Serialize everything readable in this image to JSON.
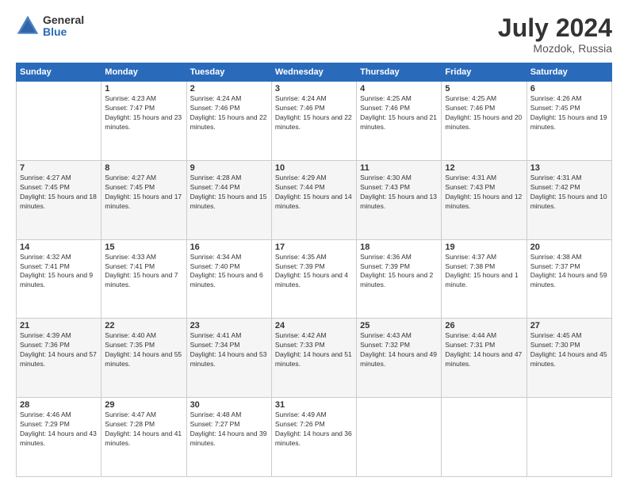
{
  "header": {
    "logo_line1": "General",
    "logo_line2": "Blue",
    "month_year": "July 2024",
    "location": "Mozdok, Russia"
  },
  "days_of_week": [
    "Sunday",
    "Monday",
    "Tuesday",
    "Wednesday",
    "Thursday",
    "Friday",
    "Saturday"
  ],
  "weeks": [
    [
      {
        "day": "",
        "sunrise": "",
        "sunset": "",
        "daylight": ""
      },
      {
        "day": "1",
        "sunrise": "Sunrise: 4:23 AM",
        "sunset": "Sunset: 7:47 PM",
        "daylight": "Daylight: 15 hours and 23 minutes."
      },
      {
        "day": "2",
        "sunrise": "Sunrise: 4:24 AM",
        "sunset": "Sunset: 7:46 PM",
        "daylight": "Daylight: 15 hours and 22 minutes."
      },
      {
        "day": "3",
        "sunrise": "Sunrise: 4:24 AM",
        "sunset": "Sunset: 7:46 PM",
        "daylight": "Daylight: 15 hours and 22 minutes."
      },
      {
        "day": "4",
        "sunrise": "Sunrise: 4:25 AM",
        "sunset": "Sunset: 7:46 PM",
        "daylight": "Daylight: 15 hours and 21 minutes."
      },
      {
        "day": "5",
        "sunrise": "Sunrise: 4:25 AM",
        "sunset": "Sunset: 7:46 PM",
        "daylight": "Daylight: 15 hours and 20 minutes."
      },
      {
        "day": "6",
        "sunrise": "Sunrise: 4:26 AM",
        "sunset": "Sunset: 7:45 PM",
        "daylight": "Daylight: 15 hours and 19 minutes."
      }
    ],
    [
      {
        "day": "7",
        "sunrise": "Sunrise: 4:27 AM",
        "sunset": "Sunset: 7:45 PM",
        "daylight": "Daylight: 15 hours and 18 minutes."
      },
      {
        "day": "8",
        "sunrise": "Sunrise: 4:27 AM",
        "sunset": "Sunset: 7:45 PM",
        "daylight": "Daylight: 15 hours and 17 minutes."
      },
      {
        "day": "9",
        "sunrise": "Sunrise: 4:28 AM",
        "sunset": "Sunset: 7:44 PM",
        "daylight": "Daylight: 15 hours and 15 minutes."
      },
      {
        "day": "10",
        "sunrise": "Sunrise: 4:29 AM",
        "sunset": "Sunset: 7:44 PM",
        "daylight": "Daylight: 15 hours and 14 minutes."
      },
      {
        "day": "11",
        "sunrise": "Sunrise: 4:30 AM",
        "sunset": "Sunset: 7:43 PM",
        "daylight": "Daylight: 15 hours and 13 minutes."
      },
      {
        "day": "12",
        "sunrise": "Sunrise: 4:31 AM",
        "sunset": "Sunset: 7:43 PM",
        "daylight": "Daylight: 15 hours and 12 minutes."
      },
      {
        "day": "13",
        "sunrise": "Sunrise: 4:31 AM",
        "sunset": "Sunset: 7:42 PM",
        "daylight": "Daylight: 15 hours and 10 minutes."
      }
    ],
    [
      {
        "day": "14",
        "sunrise": "Sunrise: 4:32 AM",
        "sunset": "Sunset: 7:41 PM",
        "daylight": "Daylight: 15 hours and 9 minutes."
      },
      {
        "day": "15",
        "sunrise": "Sunrise: 4:33 AM",
        "sunset": "Sunset: 7:41 PM",
        "daylight": "Daylight: 15 hours and 7 minutes."
      },
      {
        "day": "16",
        "sunrise": "Sunrise: 4:34 AM",
        "sunset": "Sunset: 7:40 PM",
        "daylight": "Daylight: 15 hours and 6 minutes."
      },
      {
        "day": "17",
        "sunrise": "Sunrise: 4:35 AM",
        "sunset": "Sunset: 7:39 PM",
        "daylight": "Daylight: 15 hours and 4 minutes."
      },
      {
        "day": "18",
        "sunrise": "Sunrise: 4:36 AM",
        "sunset": "Sunset: 7:39 PM",
        "daylight": "Daylight: 15 hours and 2 minutes."
      },
      {
        "day": "19",
        "sunrise": "Sunrise: 4:37 AM",
        "sunset": "Sunset: 7:38 PM",
        "daylight": "Daylight: 15 hours and 1 minute."
      },
      {
        "day": "20",
        "sunrise": "Sunrise: 4:38 AM",
        "sunset": "Sunset: 7:37 PM",
        "daylight": "Daylight: 14 hours and 59 minutes."
      }
    ],
    [
      {
        "day": "21",
        "sunrise": "Sunrise: 4:39 AM",
        "sunset": "Sunset: 7:36 PM",
        "daylight": "Daylight: 14 hours and 57 minutes."
      },
      {
        "day": "22",
        "sunrise": "Sunrise: 4:40 AM",
        "sunset": "Sunset: 7:35 PM",
        "daylight": "Daylight: 14 hours and 55 minutes."
      },
      {
        "day": "23",
        "sunrise": "Sunrise: 4:41 AM",
        "sunset": "Sunset: 7:34 PM",
        "daylight": "Daylight: 14 hours and 53 minutes."
      },
      {
        "day": "24",
        "sunrise": "Sunrise: 4:42 AM",
        "sunset": "Sunset: 7:33 PM",
        "daylight": "Daylight: 14 hours and 51 minutes."
      },
      {
        "day": "25",
        "sunrise": "Sunrise: 4:43 AM",
        "sunset": "Sunset: 7:32 PM",
        "daylight": "Daylight: 14 hours and 49 minutes."
      },
      {
        "day": "26",
        "sunrise": "Sunrise: 4:44 AM",
        "sunset": "Sunset: 7:31 PM",
        "daylight": "Daylight: 14 hours and 47 minutes."
      },
      {
        "day": "27",
        "sunrise": "Sunrise: 4:45 AM",
        "sunset": "Sunset: 7:30 PM",
        "daylight": "Daylight: 14 hours and 45 minutes."
      }
    ],
    [
      {
        "day": "28",
        "sunrise": "Sunrise: 4:46 AM",
        "sunset": "Sunset: 7:29 PM",
        "daylight": "Daylight: 14 hours and 43 minutes."
      },
      {
        "day": "29",
        "sunrise": "Sunrise: 4:47 AM",
        "sunset": "Sunset: 7:28 PM",
        "daylight": "Daylight: 14 hours and 41 minutes."
      },
      {
        "day": "30",
        "sunrise": "Sunrise: 4:48 AM",
        "sunset": "Sunset: 7:27 PM",
        "daylight": "Daylight: 14 hours and 39 minutes."
      },
      {
        "day": "31",
        "sunrise": "Sunrise: 4:49 AM",
        "sunset": "Sunset: 7:26 PM",
        "daylight": "Daylight: 14 hours and 36 minutes."
      },
      {
        "day": "",
        "sunrise": "",
        "sunset": "",
        "daylight": ""
      },
      {
        "day": "",
        "sunrise": "",
        "sunset": "",
        "daylight": ""
      },
      {
        "day": "",
        "sunrise": "",
        "sunset": "",
        "daylight": ""
      }
    ]
  ]
}
